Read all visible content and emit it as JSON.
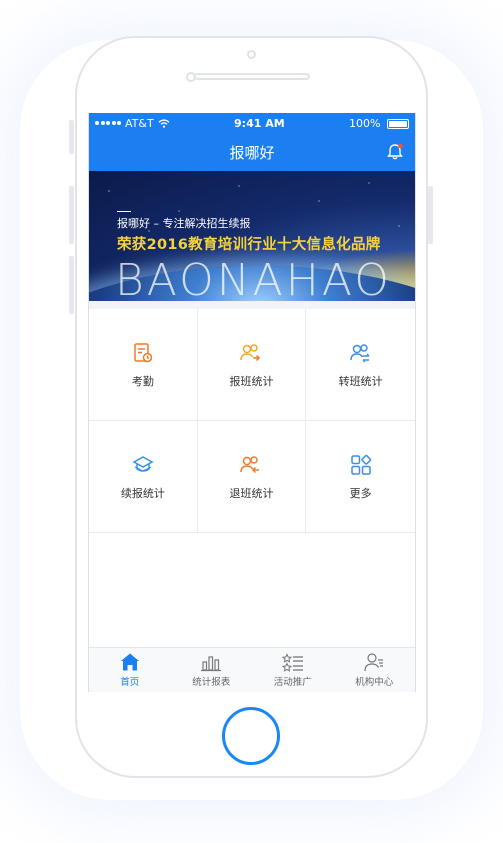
{
  "status_bar": {
    "carrier": "AT&T",
    "time": "9:41 AM",
    "battery": "100%"
  },
  "nav": {
    "title": "报哪好"
  },
  "banner": {
    "subtitle": "报哪好 – 专注解决招生续报",
    "headline": "荣获2016教育培训行业十大信息化品牌",
    "brand_text": "BAONAHAO"
  },
  "grid": {
    "items": [
      {
        "label": "考勤",
        "icon": "attendance-icon",
        "color": "#f07a2a"
      },
      {
        "label": "报班统计",
        "icon": "enroll-stats-icon",
        "color": "#f5a623"
      },
      {
        "label": "转班统计",
        "icon": "transfer-stats-icon",
        "color": "#3a8ee6"
      },
      {
        "label": "续报统计",
        "icon": "renew-stats-icon",
        "color": "#3a8ee6"
      },
      {
        "label": "退班统计",
        "icon": "withdraw-stats-icon",
        "color": "#f07a2a"
      },
      {
        "label": "更多",
        "icon": "more-grid-icon",
        "color": "#3a8ee6"
      }
    ]
  },
  "tabbar": {
    "tabs": [
      {
        "label": "首页",
        "icon": "home-icon",
        "active": true
      },
      {
        "label": "统计报表",
        "icon": "bar-chart-icon",
        "active": false
      },
      {
        "label": "活动推广",
        "icon": "promotion-list-icon",
        "active": false
      },
      {
        "label": "机构中心",
        "icon": "user-center-icon",
        "active": false
      }
    ]
  },
  "colors": {
    "primary": "#1b7ff2",
    "accent_orange": "#f07a2a",
    "accent_yellow": "#f5a623",
    "banner_gold": "#f7d33a"
  }
}
